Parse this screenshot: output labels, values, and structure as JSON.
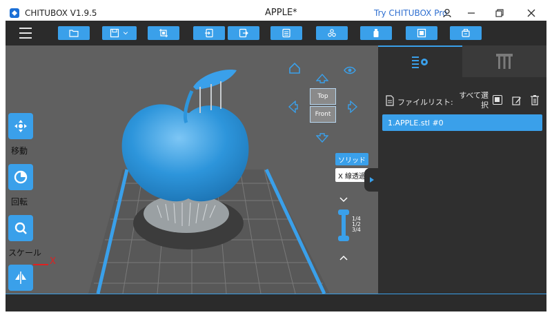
{
  "titlebar": {
    "app_name": "CHITUBOX V1.9.5",
    "document_title": "APPLE*",
    "try_pro": "Try CHITUBOX Pro"
  },
  "toolbar": {
    "buttons": [
      "open-file",
      "save",
      "crop",
      "import",
      "export",
      "list",
      "supports",
      "layers",
      "slice",
      "settings"
    ]
  },
  "side_tools": [
    {
      "label": "移動",
      "icon": "move-icon"
    },
    {
      "label": "回転",
      "icon": "rotate-icon"
    },
    {
      "label": "スケール",
      "icon": "scale-icon"
    },
    {
      "label": "",
      "icon": "mirror-icon"
    }
  ],
  "view_cube": {
    "top_label": "Top",
    "front_label": "Front"
  },
  "render_mode": {
    "solid": "ソリッド",
    "xray": "X 線透過"
  },
  "layer_slider": {
    "ticks": [
      "1/4",
      "1/2",
      "3/4"
    ]
  },
  "axis": {
    "x_label": "X"
  },
  "panel": {
    "file_list_label": "ファイルリスト:",
    "select_all": "すべて選択",
    "files": [
      {
        "name": "1.APPLE.stl #0"
      }
    ]
  },
  "colors": {
    "accent": "#3aa0ea",
    "toolbar": "#2b2b2b",
    "viewport": "#606060",
    "panel": "#2f2f2f"
  }
}
